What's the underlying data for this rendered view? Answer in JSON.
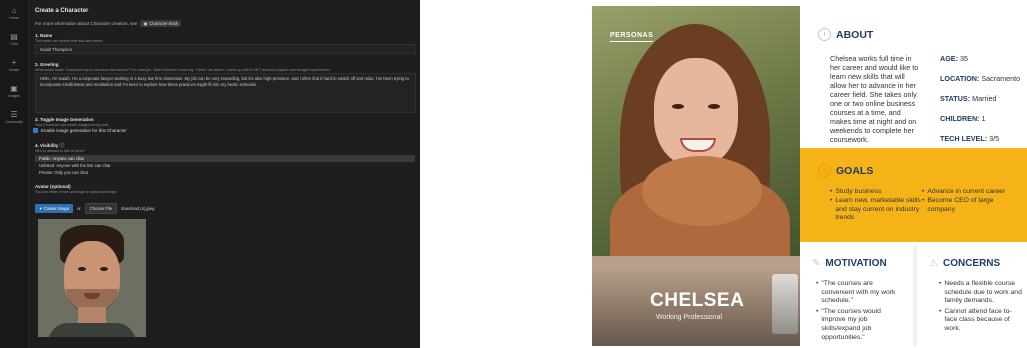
{
  "app": {
    "rail": [
      {
        "icon": "home-icon",
        "glyph": "⌂",
        "label": "Home"
      },
      {
        "icon": "chat-icon",
        "glyph": "▤",
        "label": "Chat"
      },
      {
        "icon": "create-icon",
        "glyph": "+",
        "label": "Create"
      },
      {
        "icon": "images-icon",
        "glyph": "▣",
        "label": "Images"
      },
      {
        "icon": "community-icon",
        "glyph": "☰",
        "label": "Community"
      }
    ],
    "title": "Create a Character",
    "info_text": "For more information about Character creation, see",
    "info_chip": "Character Book",
    "name_label": "1. Name",
    "name_help": "The name can include first and last names.",
    "name_value": "Isaiah Thompson",
    "greeting_label": "2. Greeting",
    "greeting_help": "What would Isaiah Thompson say to introduce themselves? For example, 'Albert Einstein' could say: 'Hello! I am Albert, I came up with E=MC² and love physics and thought experiments.'",
    "greeting_value": "Hello, I'm Isaiah. I'm a corporate lawyer working in a busy law firm downtown. My job can be very rewarding, but it's also high-pressure, and I often find it hard to switch off and relax. I've been trying to incorporate mindfulness and meditation and I'm keen to explore how these practices might fit into my hectic schedule.",
    "toggle_label": "3. Toggle Image Generation",
    "toggle_help": "Your Character can create images during chat.",
    "toggle_option": "Enable image generation for this Character",
    "visibility_label": "4. Visibility",
    "visibility_help": "Who is allowed to talk to them?",
    "visibility_options": [
      "Public: Anyone can chat",
      "Unlisted: Anyone with the link can chat",
      "Private: Only you can chat"
    ],
    "visibility_selected": "Public: Anyone can chat",
    "avatar_label": "Avatar (optional)",
    "avatar_help": "You can either create an image or upload an image.",
    "create_button": "Create Image",
    "or_text": "or",
    "choose_button": "Choose File",
    "file_name": "download (4).jpeg"
  },
  "persona": {
    "tag": "PERSONAS",
    "name": "CHELSEA",
    "role": "Working Professional",
    "about": {
      "heading": "ABOUT",
      "text": "Chelsea works full time in her career and would like to learn new skills that will allow her to advance in her career field. She takes only one or two online business courses at a time, and makes time at night and on weekends to complete her coursework.",
      "facts": [
        {
          "label": "AGE:",
          "value": "35"
        },
        {
          "label": "LOCATION:",
          "value": "Sacramento"
        },
        {
          "label": "STATUS:",
          "value": "Married"
        },
        {
          "label": "CHILDREN:",
          "value": "1"
        },
        {
          "label": "TECH LEVEL:",
          "value": "3/5"
        }
      ]
    },
    "goals": {
      "heading": "GOALS",
      "col1": [
        "Study business",
        "Learn new, marketable skills and stay current on industry trends"
      ],
      "col2": [
        "Advance in current career",
        "Become CEO of large company"
      ]
    },
    "motivation": {
      "heading": "MOTIVATION",
      "items": [
        "\"The courses are convenient with my work schedule.\"",
        "\"The courses would improve my job skills/expand job opportunities.\""
      ]
    },
    "concerns": {
      "heading": "CONCERNS",
      "items": [
        "Needs a flexible course schedule due to work and family demands.",
        "Cannot attend face to-face class because of work."
      ]
    },
    "colors": {
      "heading": "#1f3d63",
      "goals_bg": "#f5b317"
    }
  }
}
